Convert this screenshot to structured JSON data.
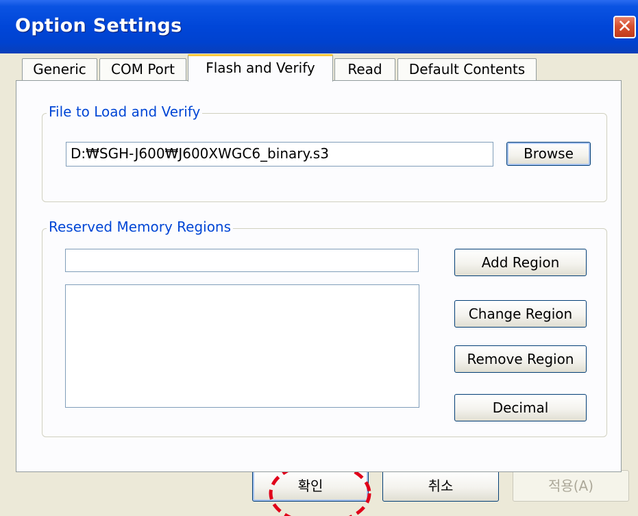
{
  "window": {
    "title": "Option Settings"
  },
  "tabs": [
    {
      "label": "Generic"
    },
    {
      "label": "COM Port"
    },
    {
      "label": "Flash and Verify"
    },
    {
      "label": "Read"
    },
    {
      "label": "Default Contents"
    }
  ],
  "file_group": {
    "label": "File to Load and Verify",
    "file_path": "D:₩SGH-J600₩J600XWGC6_binary.s3",
    "browse_label": "Browse"
  },
  "memory_group": {
    "label": "Reserved Memory Regions",
    "region_input_value": "",
    "add_label": "Add Region",
    "change_label": "Change Region",
    "remove_label": "Remove Region",
    "decimal_label": "Decimal"
  },
  "footer": {
    "ok_label": "확인",
    "cancel_label": "취소",
    "apply_label": "적용(A)"
  },
  "annotation": {
    "color": "#e0001a"
  }
}
